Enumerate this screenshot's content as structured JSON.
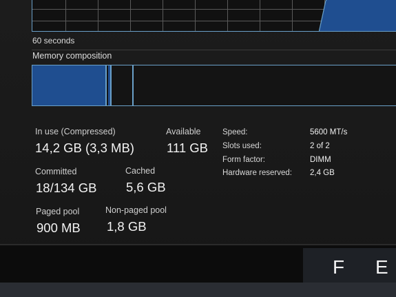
{
  "graph": {
    "time_label": "60 seconds"
  },
  "composition": {
    "title": "Memory composition"
  },
  "stats": {
    "in_use": {
      "label": "In use (Compressed)",
      "value": "14,2 GB (3,3 MB)"
    },
    "available": {
      "label": "Available",
      "value": "111 GB"
    },
    "committed": {
      "label": "Committed",
      "value": "18/134 GB"
    },
    "cached": {
      "label": "Cached",
      "value": "5,6 GB"
    },
    "paged_pool": {
      "label": "Paged pool",
      "value": "900 MB"
    },
    "non_paged_pool": {
      "label": "Non-paged pool",
      "value": "1,8 GB"
    }
  },
  "specs": [
    {
      "label": "Speed:",
      "value": "5600 MT/s"
    },
    {
      "label": "Slots used:",
      "value": "2 of 2"
    },
    {
      "label": "Form factor:",
      "value": "DIMM"
    },
    {
      "label": "Hardware reserved:",
      "value": "2,4 GB"
    }
  ],
  "keyboard": {
    "key_f": "F",
    "key_e": "E"
  },
  "colors": {
    "accent_border": "#6aa0c9",
    "in_use_fill": "#1f4e90",
    "background": "#1c1c1c"
  }
}
